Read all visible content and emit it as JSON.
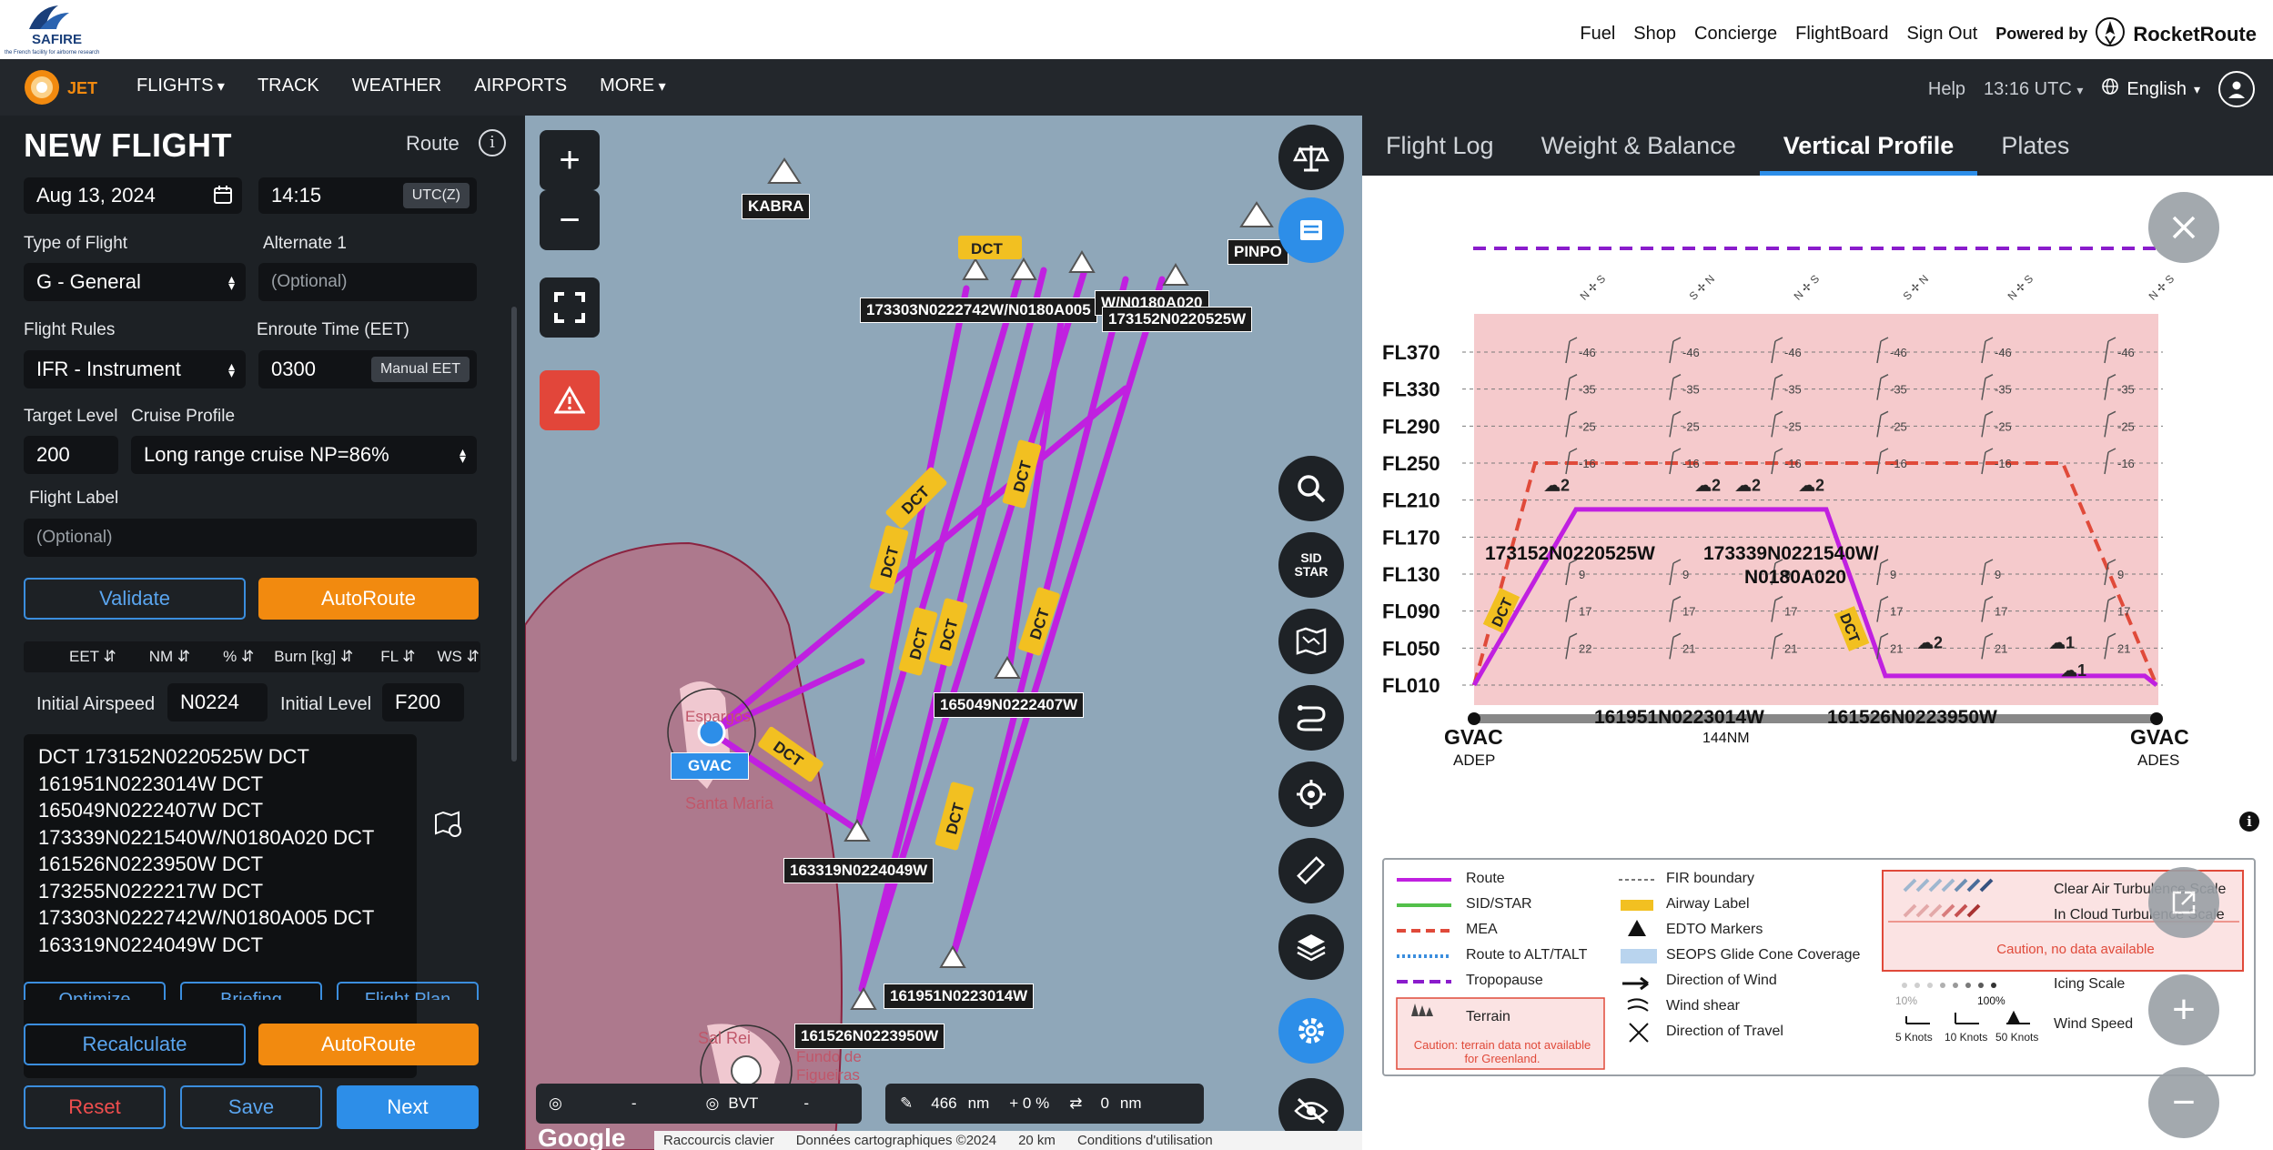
{
  "topbar": {
    "logo_text": "SAFIRE",
    "logo_subtext": "the French facility for airborne research",
    "links": [
      "Fuel",
      "Shop",
      "Concierge",
      "FlightBoard",
      "Sign Out"
    ],
    "powered_by": "Powered by",
    "brand": "RocketRoute"
  },
  "nav": {
    "logo_text": "JET",
    "items": [
      "FLIGHTS",
      "TRACK",
      "WEATHER",
      "AIRPORTS",
      "MORE"
    ],
    "help": "Help",
    "time": "13:16",
    "timezone": "UTC",
    "language": "English"
  },
  "form": {
    "title": "NEW FLIGHT",
    "route_label": "Route",
    "date": "Aug 13, 2024",
    "time": "14:15",
    "time_zone_tag": "UTC(Z)",
    "type_label": "Type of Flight",
    "type_value": "G - General",
    "alternate_label": "Alternate 1",
    "alternate_placeholder": "(Optional)",
    "rules_label": "Flight Rules",
    "rules_value": "IFR - Instrument",
    "eet_label": "Enroute Time (EET)",
    "eet_value": "0300",
    "eet_tag": "Manual EET",
    "target_label": "Target Level",
    "target_value": "200",
    "cruise_label": "Cruise Profile",
    "cruise_value": "Long range cruise NP=86%",
    "flight_label_label": "Flight Label",
    "flight_label_placeholder": "(Optional)",
    "validate": "Validate",
    "autoroute": "AutoRoute",
    "columns": [
      "EET",
      "NM",
      "%",
      "Burn [kg]",
      "FL",
      "WS"
    ],
    "initial_airspeed_label": "Initial Airspeed",
    "initial_airspeed_value": "N0224",
    "initial_level_label": "Initial Level",
    "initial_level_value": "F200",
    "route_text": "DCT 173152N0220525W DCT\n161951N0223014W DCT\n165049N0222407W DCT\n173339N0221540W/N0180A020 DCT\n161526N0223950W DCT\n173255N0222217W DCT\n173303N0222742W/N0180A005 DCT\n163319N0224049W DCT",
    "optimize": "Optimize",
    "briefing": "Briefing",
    "flight_plan": "Flight Plan",
    "recalculate": "Recalculate",
    "autoroute2": "AutoRoute",
    "reset": "Reset",
    "save": "Save",
    "next": "Next"
  },
  "map": {
    "waypoints": {
      "kabra": "KABRA",
      "pinpo": "PINPO",
      "wp1": "173303N0222742W/N0180A005",
      "wp2": "W/N0180A020",
      "wp3": "173152N0220525W",
      "wp4": "165049N0222407W",
      "wp5": "163319N0224049W",
      "wp6": "161951N0223014W",
      "wp7": "161526N0223950W",
      "gvac": "GVAC",
      "town1": "Santa Maria",
      "town2": "Sal Rei",
      "town3": "Fundo de Figueiras",
      "town_partial": "Espargos"
    },
    "airway_label": "DCT",
    "sid_star": "SID\nSTAR",
    "scale_label_left": "-",
    "scale_label_bvt": "BVT",
    "scale_label_dash": "-",
    "dist": "466",
    "dist_unit": "nm",
    "pct": "+ 0 %",
    "alt_dist": "0",
    "alt_unit": "nm",
    "attribution": [
      "Raccourcis clavier",
      "Données cartographiques ©2024",
      "20 km",
      "Conditions d'utilisation"
    ],
    "google": "Google"
  },
  "tabs": [
    "Flight Log",
    "Weight & Balance",
    "Vertical Profile",
    "Plates"
  ],
  "active_tab": "Vertical Profile",
  "chart_data": {
    "type": "line",
    "levels": [
      "FL370",
      "FL330",
      "FL290",
      "FL250",
      "FL210",
      "FL170",
      "FL130",
      "FL090",
      "FL050",
      "FL010"
    ],
    "departure": "GVAC",
    "departure_label": "ADEP",
    "arrival": "GVAC",
    "arrival_label": "ADES",
    "distance_label": "144NM",
    "route_points": [
      {
        "name": "GVAC",
        "fl": 10
      },
      {
        "name": "173152N0220525W",
        "fl": 200
      },
      {
        "name": "173339N0221540W/ N0180A020",
        "fl": 200
      },
      {
        "name": "",
        "fl": 200
      },
      {
        "name": "",
        "fl": 20
      },
      {
        "name": "GVAC",
        "fl": 10
      }
    ],
    "ground_labels": [
      "161951N0223014W",
      "161526N0223950W"
    ],
    "tropopause_fl": 420,
    "mea_fl": 250,
    "wind_temps_row1": [
      "-46",
      "-46",
      "-46",
      "-46",
      "-46",
      "-46"
    ],
    "wind_temps_row2": [
      "-35",
      "-35",
      "-35",
      "-35",
      "-35",
      "-35"
    ],
    "wind_temps_row3": [
      "-25",
      "-25",
      "-25",
      "-25",
      "-25",
      "-25"
    ],
    "wind_temps_row4": [
      "-16",
      "-16",
      "-16",
      "-16",
      "-16",
      "-16"
    ],
    "wind_temps_row5": [
      "9",
      "9",
      "9",
      "9",
      "9",
      "9"
    ],
    "wind_temps_row6": [
      "17",
      "17",
      "17",
      "17",
      "17",
      "17"
    ],
    "wind_temps_row7": [
      "22",
      "21",
      "21",
      "21",
      "21",
      "21"
    ],
    "cloud_icons": [
      "2",
      "2",
      "2",
      "2",
      "2",
      "1",
      "1"
    ],
    "legend": {
      "route": "Route",
      "sidstar": "SID/STAR",
      "mea": "MEA",
      "alt": "Route to ALT/TALT",
      "trop": "Tropopause",
      "terrain": "Terrain",
      "terrain_caution": "Caution: terrain data not available for Greenland.",
      "fir": "FIR boundary",
      "airway": "Airway Label",
      "edto": "EDTO Markers",
      "seops": "SEOPS Glide Cone Coverage",
      "dir_wind": "Direction of Wind",
      "wind_shear": "Wind shear",
      "dir_travel": "Direction of Travel",
      "cat": "Clear Air Turbulence Scale",
      "ict": "In Cloud Turbulence Scale",
      "no_data": "Caution, no data available",
      "icing": "Icing Scale",
      "icing_low": "10%",
      "icing_high": "100%",
      "wind_speed": "Wind Speed",
      "knots": [
        "5 Knots",
        "10 Knots",
        "50 Knots"
      ]
    }
  },
  "colors": {
    "route": "#c020e0",
    "mea": "#e04a3a",
    "tropopause": "#8a1ccc",
    "airway_label": "#f2c021",
    "accent": "#2d8ee8",
    "orange": "#f28a0f"
  }
}
